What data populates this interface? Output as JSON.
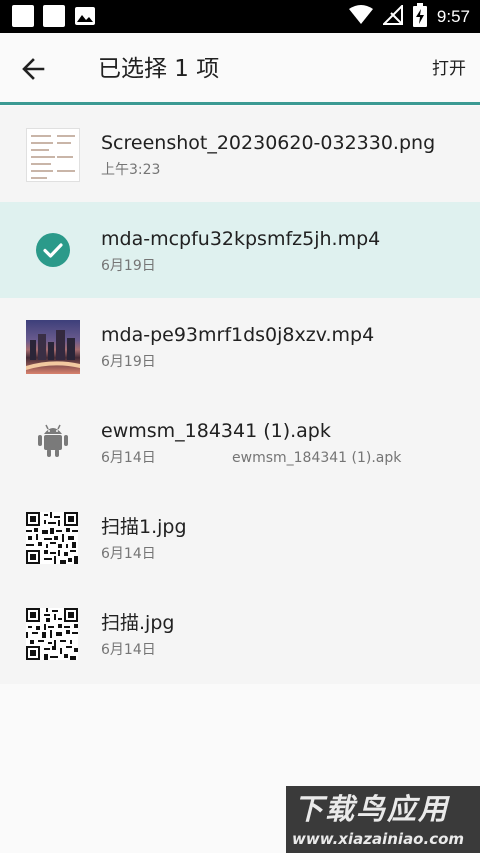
{
  "status_bar": {
    "time": "9:57",
    "icons": [
      "square-icon",
      "square-icon",
      "image-icon",
      "wifi-icon",
      "no-signal-icon",
      "battery-charging-icon"
    ]
  },
  "app_bar": {
    "title": "已选择 1 项",
    "open_label": "打开",
    "back_icon": "arrow-back-icon",
    "accent_color": "#3b9a93"
  },
  "files": [
    {
      "name": "Screenshot_20230620-032330.png",
      "date": "上午3:23",
      "summary": "",
      "thumb": "screenshot",
      "selected": false
    },
    {
      "name": "mda-mcpfu32kpsmfz5jh.mp4",
      "date": "6月19日",
      "summary": "",
      "thumb": "check",
      "selected": true
    },
    {
      "name": "mda-pe93mrf1ds0j8xzv.mp4",
      "date": "6月19日",
      "summary": "",
      "thumb": "video",
      "selected": false
    },
    {
      "name": "ewmsm_184341 (1).apk",
      "date": "6月14日",
      "summary": "ewmsm_184341 (1).apk",
      "thumb": "android",
      "selected": false
    },
    {
      "name": "扫描1.jpg",
      "date": "6月14日",
      "summary": "",
      "thumb": "qr",
      "selected": false
    },
    {
      "name": "扫描.jpg",
      "date": "6月14日",
      "summary": "",
      "thumb": "qr",
      "selected": false
    }
  ],
  "watermark": {
    "brand": "下载鸟应用",
    "url": "www.xiazainiao.com"
  },
  "colors": {
    "selected_row": "#dff1ef",
    "check_circle": "#2b9a8a"
  }
}
